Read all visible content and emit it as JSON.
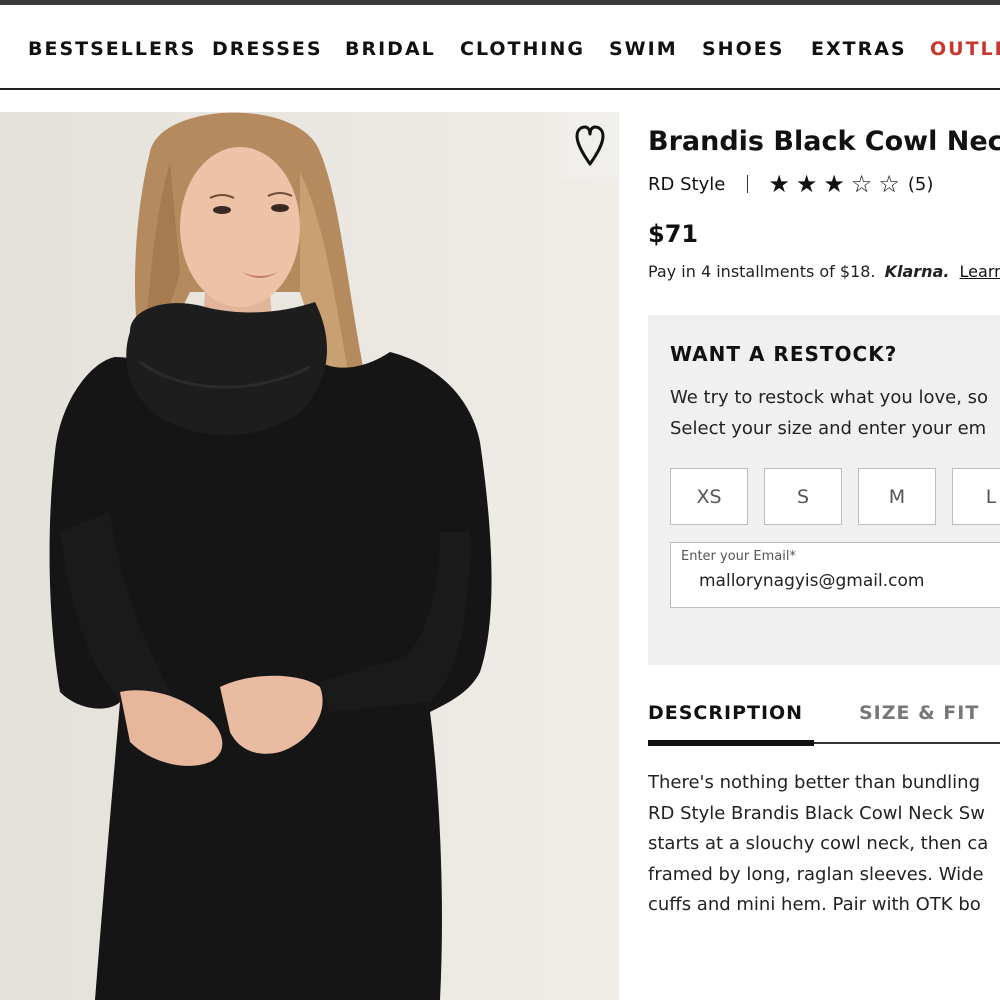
{
  "nav": {
    "items": [
      "BESTSELLERS",
      "DRESSES",
      "BRIDAL",
      "CLOTHING",
      "SWIM",
      "SHOES",
      "EXTRAS"
    ],
    "outlet": "OUTLE"
  },
  "product": {
    "title": "Brandis Black Cowl Neck",
    "brand": "RD Style",
    "rating": 3,
    "rating_max": 5,
    "stars_display": "★★★☆☆",
    "review_count": "(5)",
    "price": "$71",
    "klarna": {
      "prefix": "Pay in 4 installments of $18.",
      "brand": "Klarna.",
      "link": "Learn"
    },
    "image_alt": "Model wearing black cowl neck sweater dress"
  },
  "wishlist": {
    "icon": "heart-outline-icon"
  },
  "restock": {
    "title": "WANT A RESTOCK?",
    "lines": [
      "We try to restock what you love, so",
      "Select your size and enter your em"
    ],
    "sizes": [
      "XS",
      "S",
      "M",
      "L"
    ],
    "email": {
      "label": "Enter your Email*",
      "value": "mallorynagyis@gmail.com"
    }
  },
  "tabs": {
    "description": "DESCRIPTION",
    "size_fit": "SIZE & FIT",
    "active": "description"
  },
  "description": {
    "lines": [
      "There's nothing better than bundling",
      "RD Style Brandis Black Cowl Neck Sw",
      "starts at a slouchy cowl neck, then ca",
      "framed by long, raglan sleeves. Wide",
      "cuffs and mini hem. Pair with OTK bo"
    ]
  },
  "colors": {
    "outlet": "#c8362d",
    "panel": "#f0f0f0",
    "text": "#111111"
  }
}
